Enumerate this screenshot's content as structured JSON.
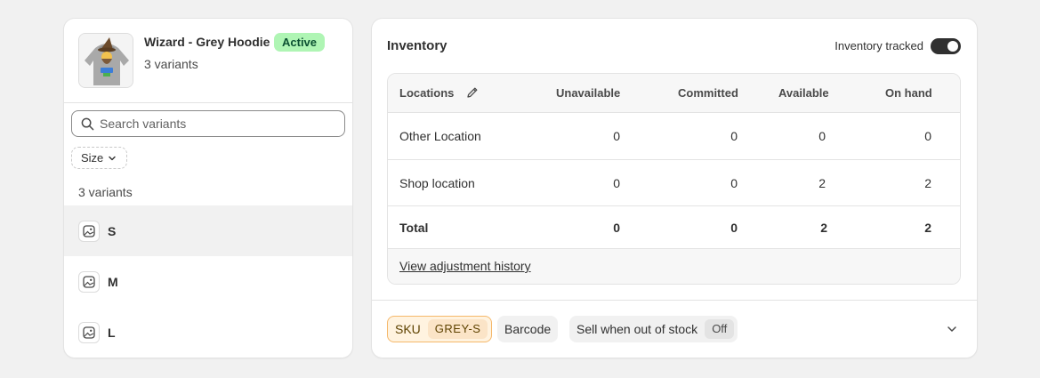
{
  "product": {
    "title": "Wizard - Grey Hoodie",
    "status": "Active",
    "variant_summary": "3 variants",
    "thumbnail_icon": "hoodie-product-image"
  },
  "variants_panel": {
    "search_placeholder": "Search variants",
    "filter_label": "Size",
    "count_label": "3 variants",
    "items": [
      {
        "label": "S",
        "selected": true
      },
      {
        "label": "M",
        "selected": false
      },
      {
        "label": "L",
        "selected": false
      }
    ]
  },
  "inventory": {
    "title": "Inventory",
    "tracked_label": "Inventory tracked",
    "tracked": true,
    "columns": [
      "Locations",
      "Unavailable",
      "Committed",
      "Available",
      "On hand"
    ],
    "rows": [
      {
        "location": "Other Location",
        "unavailable": "0",
        "committed": "0",
        "available": "0",
        "on_hand": "0"
      },
      {
        "location": "Shop location",
        "unavailable": "0",
        "committed": "0",
        "available": "2",
        "on_hand": "2"
      }
    ],
    "total": {
      "label": "Total",
      "unavailable": "0",
      "committed": "0",
      "available": "2",
      "on_hand": "2"
    },
    "history_link": "View adjustment history"
  },
  "footer": {
    "sku_label": "SKU",
    "sku_value": "GREY-S",
    "barcode_label": "Barcode",
    "sell_oos_label": "Sell when out of stock",
    "sell_oos_value": "Off"
  },
  "colors": {
    "active_badge_bg": "#aff5b4",
    "toggle_on": "#303030",
    "sku_highlight": "#fff3e0"
  }
}
